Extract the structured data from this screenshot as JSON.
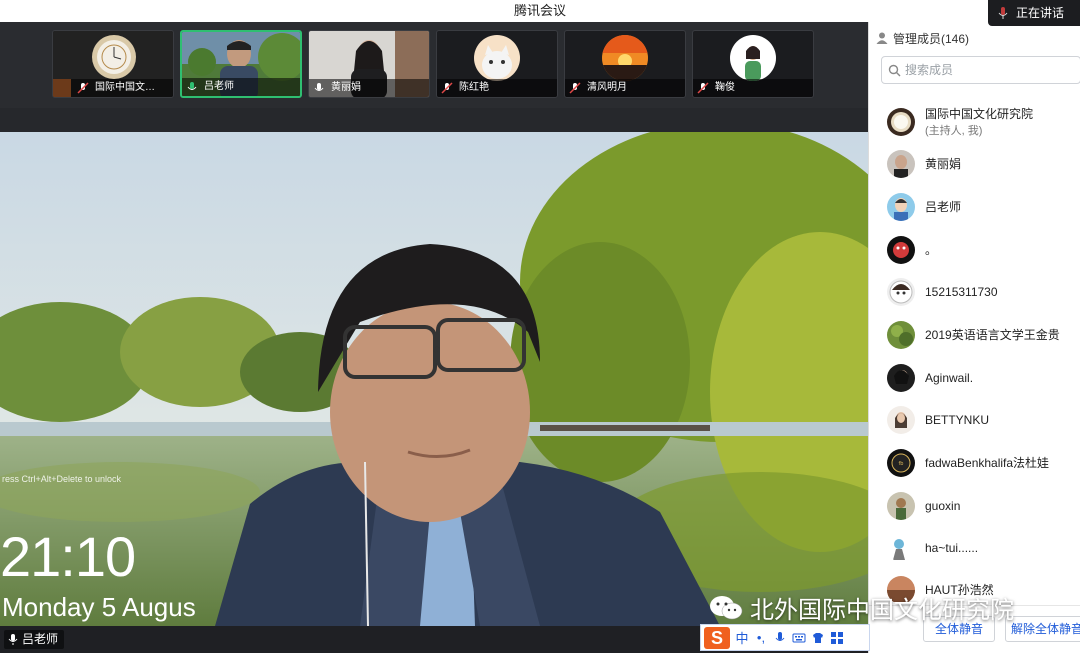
{
  "window": {
    "title": "腾讯会议",
    "speaking_label": "正在讲话"
  },
  "thumbnails": [
    {
      "name": "国际中国文…",
      "host": true
    },
    {
      "name": "吕老师",
      "active": true
    },
    {
      "name": "黄丽娟"
    },
    {
      "name": "陈红艳"
    },
    {
      "name": "清风明月"
    },
    {
      "name": "鞠俊"
    }
  ],
  "main_video": {
    "speaker_name": "吕老师",
    "lockscreen_hint": "ress Ctrl+Alt+Delete to unlock",
    "clock": "21:10",
    "date": "Monday 5 Augus"
  },
  "watermark": {
    "text": "北外国际中国文化研究院"
  },
  "ime": {
    "logo": "S",
    "mode": "中",
    "punct": "•,"
  },
  "panel": {
    "header": "管理成员(146)",
    "search_placeholder": "搜索成员",
    "members": [
      {
        "name": "国际中国文化研究院",
        "sub": "(主持人, 我)"
      },
      {
        "name": "黄丽娟"
      },
      {
        "name": "吕老师"
      },
      {
        "name": "。"
      },
      {
        "name": "15215311730"
      },
      {
        "name": "2019英语语言文学王金贵"
      },
      {
        "name": "Aginwail."
      },
      {
        "name": "BETTYNKU"
      },
      {
        "name": "fadwaBenkhalifa法杜娃"
      },
      {
        "name": "guoxin"
      },
      {
        "name": "ha~tui......"
      },
      {
        "name": "HAUT孙浩然"
      }
    ],
    "mute_all": "全体静音",
    "unmute_all": "解除全体静音"
  },
  "colors": {
    "accent": "#1f5bd8",
    "active_border": "#2fbf71",
    "host_badge": "#f0813b",
    "ime_logo": "#f0601f"
  }
}
